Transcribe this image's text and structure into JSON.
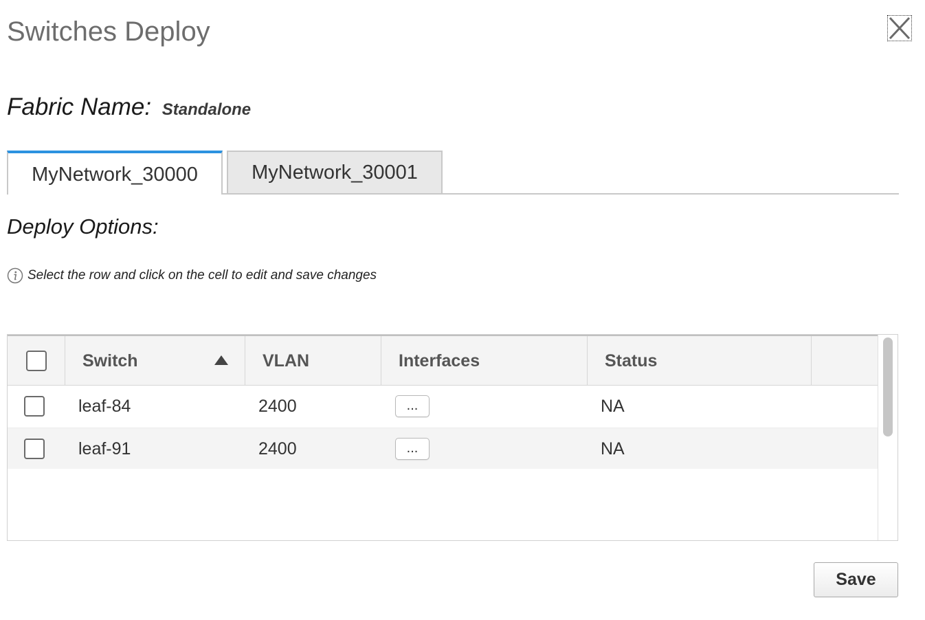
{
  "dialog": {
    "title": "Switches Deploy"
  },
  "fabric": {
    "label": "Fabric Name:",
    "value": "Standalone"
  },
  "tabs": [
    {
      "label": "MyNetwork_30000",
      "active": true
    },
    {
      "label": "MyNetwork_30001",
      "active": false
    }
  ],
  "deploy_options": {
    "heading": "Deploy Options:",
    "info_text": "Select the row and click on the cell to edit and save changes"
  },
  "table": {
    "columns": [
      "Switch",
      "VLAN",
      "Interfaces",
      "Status"
    ],
    "sort": {
      "column": "Switch",
      "direction": "ascending"
    },
    "rows": [
      {
        "switch": "leaf-84",
        "vlan": "2400",
        "interfaces_button": "...",
        "status": "NA",
        "checked": false
      },
      {
        "switch": "leaf-91",
        "vlan": "2400",
        "interfaces_button": "...",
        "status": "NA",
        "checked": false
      }
    ]
  },
  "footer": {
    "save_label": "Save"
  },
  "colors": {
    "active_tab_accent": "#2c92e0",
    "header_background": "#f4f4f4",
    "inactive_tab_background": "#e8e8e8"
  },
  "icons": {
    "close": "close-icon",
    "info": "info-icon",
    "sort": "sort-ascending-icon"
  }
}
